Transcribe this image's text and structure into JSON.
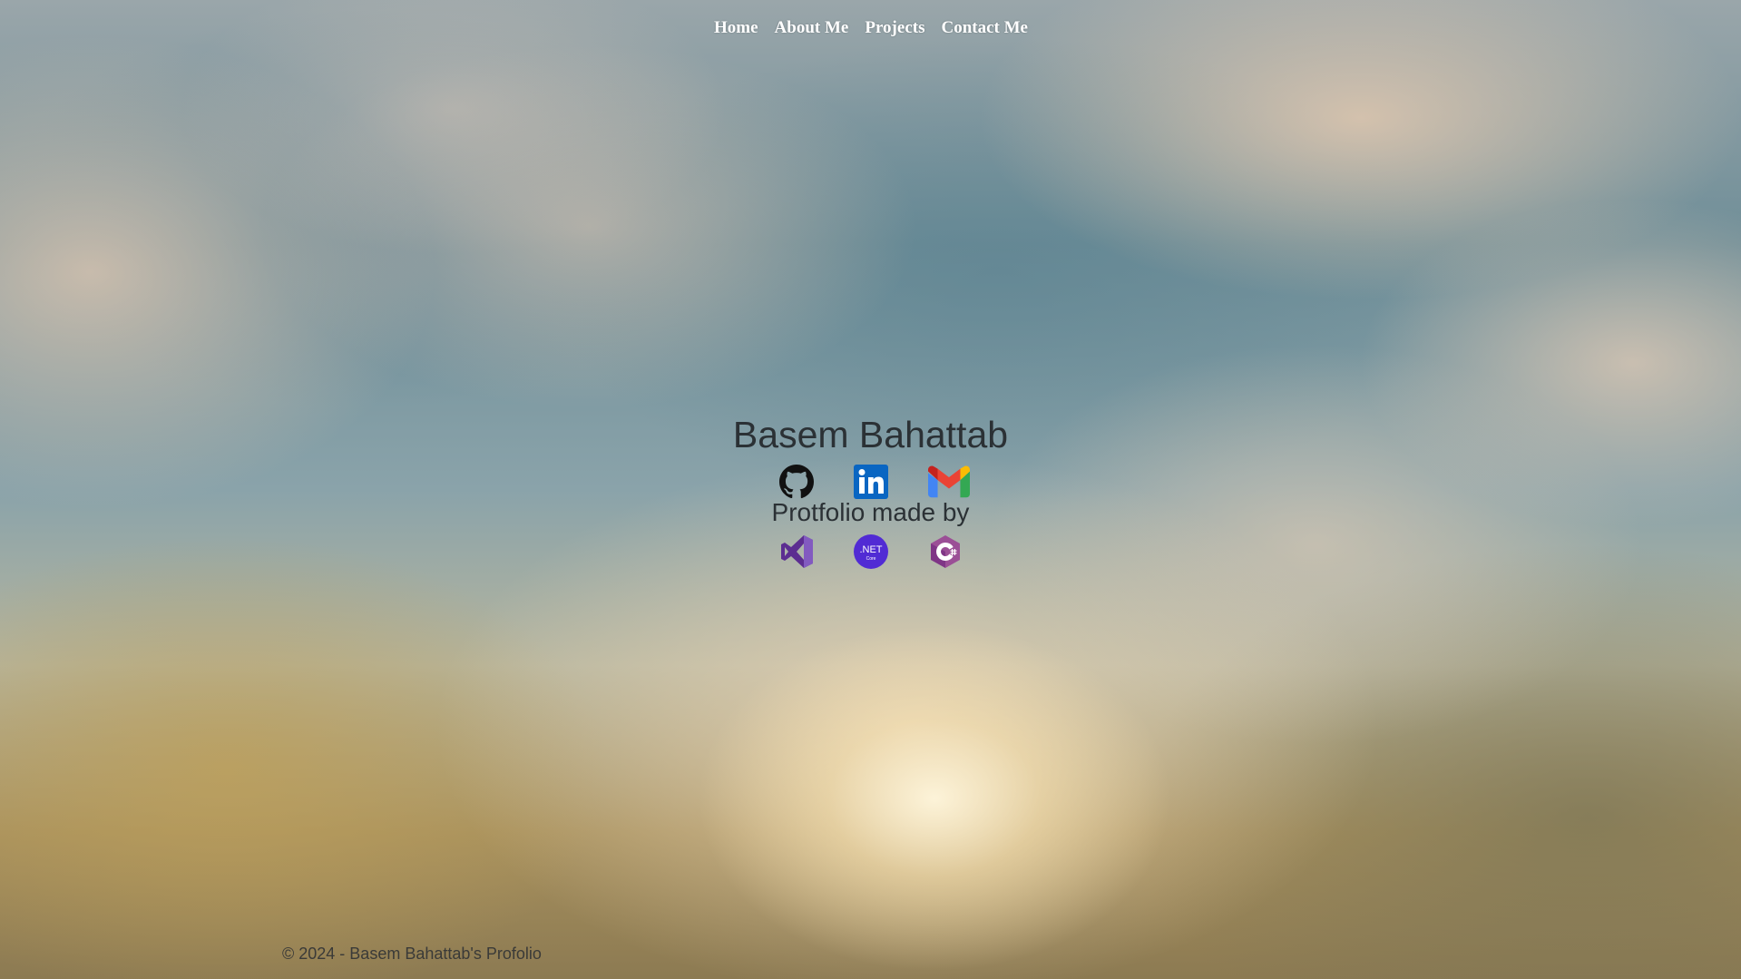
{
  "nav": {
    "items": [
      {
        "label": "Home"
      },
      {
        "label": "About Me"
      },
      {
        "label": "Projects"
      },
      {
        "label": "Contact Me"
      }
    ]
  },
  "hero": {
    "name": "Basem Bahattab",
    "made_by": "Protfolio made by",
    "social_icons": [
      "github-icon",
      "linkedin-icon",
      "gmail-icon"
    ],
    "tech_icons": [
      "visual-studio-icon",
      "dotnet-core-icon",
      "csharp-icon"
    ],
    "dotnet_icon_text": ".NET",
    "dotnet_icon_subtext": "Core",
    "text_color": "#2b3135"
  },
  "footer": {
    "text": "© 2024 - Basem Bahattab's Profolio"
  },
  "colors": {
    "nav_text": "#ffffff",
    "linkedin": "#0a66c2",
    "dotnet": "#512bd4",
    "csharp": "#68217a"
  }
}
